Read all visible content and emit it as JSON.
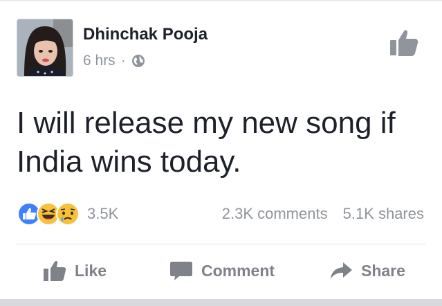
{
  "post": {
    "author": "Dhinchak Pooja",
    "time": "6 hrs",
    "separator": "·",
    "text": "I will release my new song if India wins today."
  },
  "stats": {
    "reactions_count": "3.5K",
    "comments": "2.3K comments",
    "shares": "5.1K shares"
  },
  "actions": {
    "like": "Like",
    "comment": "Comment",
    "share": "Share"
  },
  "colors": {
    "like_blue": "#4080ff",
    "emoji_yellow": "#f7c23a",
    "text": "#1d2129",
    "muted": "#90949c",
    "action_gray": "#7f8289"
  },
  "icons": [
    "globe-icon",
    "thumbs-up-icon",
    "like-reaction-icon",
    "haha-reaction-icon",
    "sad-reaction-icon",
    "comment-icon",
    "share-arrow-icon"
  ]
}
